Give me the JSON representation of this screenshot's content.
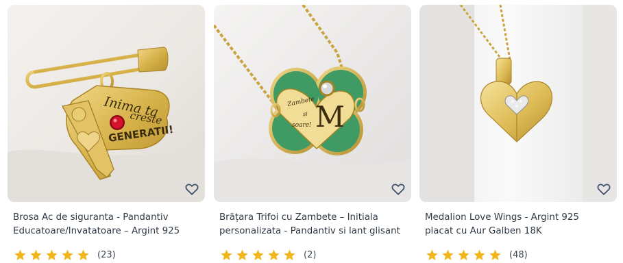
{
  "products": [
    {
      "line1": "Brosa Ac de siguranta - Pandantiv",
      "line2": "Educatoare/Invatatoare – Argint 925",
      "rating": 5,
      "reviews": "(23)",
      "charm_text": [
        "Inima ta",
        "creste",
        "GENERATII!"
      ]
    },
    {
      "line1": "Brățara Trifoi cu Zambete – Initiala",
      "line2": "personalizata - Pandantiv si lant glisant",
      "rating": 5,
      "reviews": "(2)",
      "charm_text": [
        "Zambete",
        "și",
        "soare!",
        "M"
      ]
    },
    {
      "line1": "Medalion Love Wings - Argint 925",
      "line2": "placat cu Aur Galben 18K",
      "rating": 5,
      "reviews": "(48)"
    }
  ],
  "icons": {
    "wishlist": "heart-outline-icon",
    "rating": "star-icon"
  },
  "colors": {
    "star": "#f2b61d",
    "heart": "#3b4e68",
    "gold": "#d7b24a",
    "enamel_green": "#3f9b63",
    "crystal_red": "#d3142c",
    "text": "#2f3a45"
  }
}
